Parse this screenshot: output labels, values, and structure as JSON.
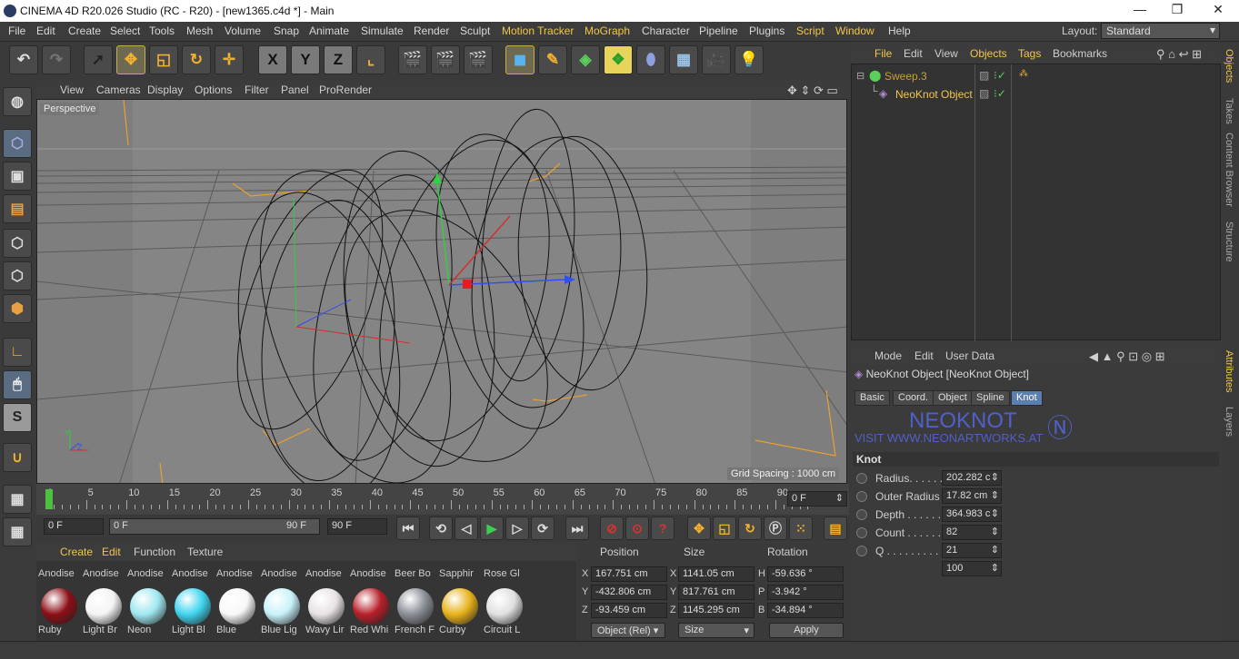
{
  "window": {
    "title": "CINEMA 4D R20.026 Studio (RC - R20) - [new1365.c4d *] - Main",
    "min": "—",
    "max": "❐",
    "close": "✕"
  },
  "menu": [
    "File",
    "Edit",
    "Create",
    "Select",
    "Tools",
    "Mesh",
    "Volume",
    "Snap",
    "Animate",
    "Simulate",
    "Render",
    "Sculpt",
    "Motion Tracker",
    "MoGraph",
    "Character",
    "Pipeline",
    "Plugins",
    "Script",
    "Window",
    "Help"
  ],
  "layout": {
    "label": "Layout:",
    "value": "Standard"
  },
  "toolbar": {
    "x": "X",
    "y": "Y",
    "z": "Z"
  },
  "viewport": {
    "menu": [
      "View",
      "Cameras",
      "Display",
      "Options",
      "Filter",
      "Panel",
      "ProRender"
    ],
    "camera_label": "Perspective",
    "grid_spacing": "Grid Spacing : 1000 cm"
  },
  "timeline": {
    "ticks": [
      "0",
      "5",
      "10",
      "15",
      "20",
      "25",
      "30",
      "35",
      "40",
      "45",
      "50",
      "55",
      "60",
      "65",
      "70",
      "75",
      "80",
      "85",
      "90"
    ],
    "current_frame": "0 F"
  },
  "transport": {
    "start": "0 F",
    "range_start": "0 F",
    "range_end": "90 F",
    "end": "90 F"
  },
  "materials": {
    "menu": [
      "Create",
      "Edit",
      "Function",
      "Texture"
    ],
    "top_row": [
      "Anodise",
      "Anodise",
      "Anodise",
      "Anodise",
      "Anodise",
      "Anodise",
      "Anodise",
      "Anodise",
      "Beer Bo",
      "Sapphir",
      "Rose Gl"
    ],
    "items": [
      {
        "name": "Ruby",
        "color": "#8c0f16"
      },
      {
        "name": "Light Br",
        "color": "#f4f4f4"
      },
      {
        "name": "Neon",
        "color": "#9ee8f0"
      },
      {
        "name": "Light Bl",
        "color": "#3fd4ef"
      },
      {
        "name": "Blue",
        "color": "#f8f8f8"
      },
      {
        "name": "Blue Lig",
        "color": "#c8f2fa"
      },
      {
        "name": "Wavy Lir",
        "color": "#e8e2e4"
      },
      {
        "name": "Red Whi",
        "color": "#b8202a"
      },
      {
        "name": "French F",
        "color": "#8a8f96"
      },
      {
        "name": "Curby",
        "color": "#e8b21a"
      },
      {
        "name": "Circuit L",
        "color": "#e0e0e0"
      }
    ]
  },
  "coords": {
    "headers": [
      "Position",
      "Size",
      "Rotation"
    ],
    "rows": [
      {
        "axis": "X",
        "pos": "167.751 cm",
        "size_axis": "X",
        "size": "1141.05 cm",
        "rot_axis": "H",
        "rot": "-59.636 °"
      },
      {
        "axis": "Y",
        "pos": "-432.806 cm",
        "size_axis": "Y",
        "size": "817.761 cm",
        "rot_axis": "P",
        "rot": "-3.942 °"
      },
      {
        "axis": "Z",
        "pos": "-93.459 cm",
        "size_axis": "Z",
        "size": "1145.295 cm",
        "rot_axis": "B",
        "rot": "-34.894 °"
      }
    ],
    "mode": "Object (Rel)",
    "size_mode": "Size",
    "apply": "Apply"
  },
  "objects": {
    "tabs": [
      "File",
      "Edit",
      "View",
      "Objects",
      "Tags",
      "Bookmarks"
    ],
    "items": [
      {
        "name": "Sweep.3",
        "color": "#c9a038"
      },
      {
        "name": "NeoKnot Object",
        "color": "#f2c64a"
      }
    ]
  },
  "side_tabs": [
    "Objects",
    "Takes",
    "Content Browser",
    "Structure",
    "Attributes",
    "Layers"
  ],
  "attributes": {
    "menu": [
      "Mode",
      "Edit",
      "User Data"
    ],
    "title": "NeoKnot Object [NeoKnot Object]",
    "tabs": [
      "Basic",
      "Coord.",
      "Object",
      "Spline",
      "Knot"
    ],
    "logo_text": "NEOKNOT",
    "logo_sub": "VISIT WWW.NEONARTWORKS.AT",
    "section": "Knot",
    "params": [
      {
        "label": "Radius. . . . . .",
        "value": "202.282 cı"
      },
      {
        "label": "Outer Radius",
        "value": "17.82 cm"
      },
      {
        "label": "Depth . . . . . .",
        "value": "364.983 cı"
      },
      {
        "label": "Count . . . . . .",
        "value": "82"
      },
      {
        "label": "Q . . . . . . . . . .",
        "value": "21"
      },
      {
        "label": "",
        "value": "100"
      }
    ]
  }
}
